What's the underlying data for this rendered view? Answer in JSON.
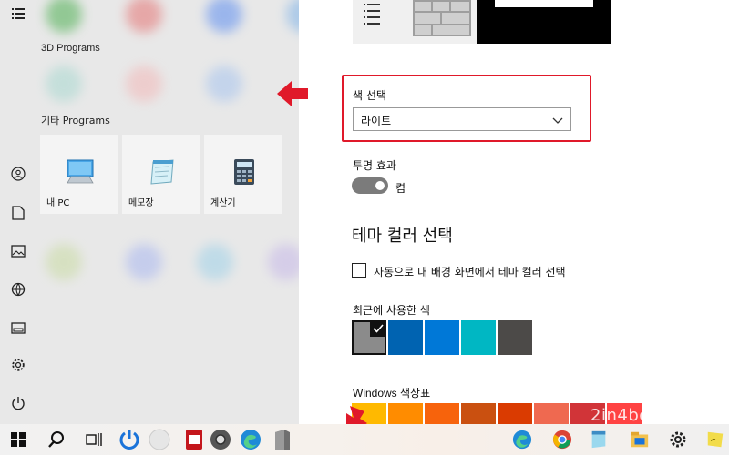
{
  "start_menu": {
    "groups": [
      {
        "title": "3D Programs"
      },
      {
        "title": "기타 Programs"
      }
    ],
    "tiles": [
      {
        "label": "내 PC",
        "icon": "pc-icon"
      },
      {
        "label": "메모장",
        "icon": "notepad-icon"
      },
      {
        "label": "계산기",
        "icon": "calculator-icon"
      }
    ],
    "rail_icons": [
      "expand-list-icon",
      "user-icon",
      "document-icon",
      "pictures-icon",
      "network-icon",
      "file-explorer-icon",
      "settings-icon",
      "power-icon"
    ]
  },
  "settings": {
    "color_choice": {
      "label": "색 선택",
      "value": "라이트"
    },
    "transparency": {
      "label": "투명 효과",
      "state_label": "켬",
      "on": true
    },
    "accent": {
      "heading": "테마 컬러 선택",
      "auto_checkbox_label": "자동으로 내 배경 화면에서 테마 컬러 선택",
      "auto_checked": false
    },
    "recent": {
      "label": "최근에 사용한 색",
      "colors": [
        "#8b8b8b",
        "#0063b1",
        "#0078d7",
        "#00b7c3",
        "#4c4a48"
      ]
    },
    "palette": {
      "label": "Windows 색상표",
      "colors": [
        "#ffb900",
        "#ff8c00",
        "#f7630c",
        "#ca5010",
        "#da3b01",
        "#ef6950",
        "#d13438",
        "#ff4343"
      ]
    }
  },
  "watermark": "2in4boi.com",
  "colors": {
    "highlight": "#e0192a",
    "arrow": "#e0192a"
  }
}
